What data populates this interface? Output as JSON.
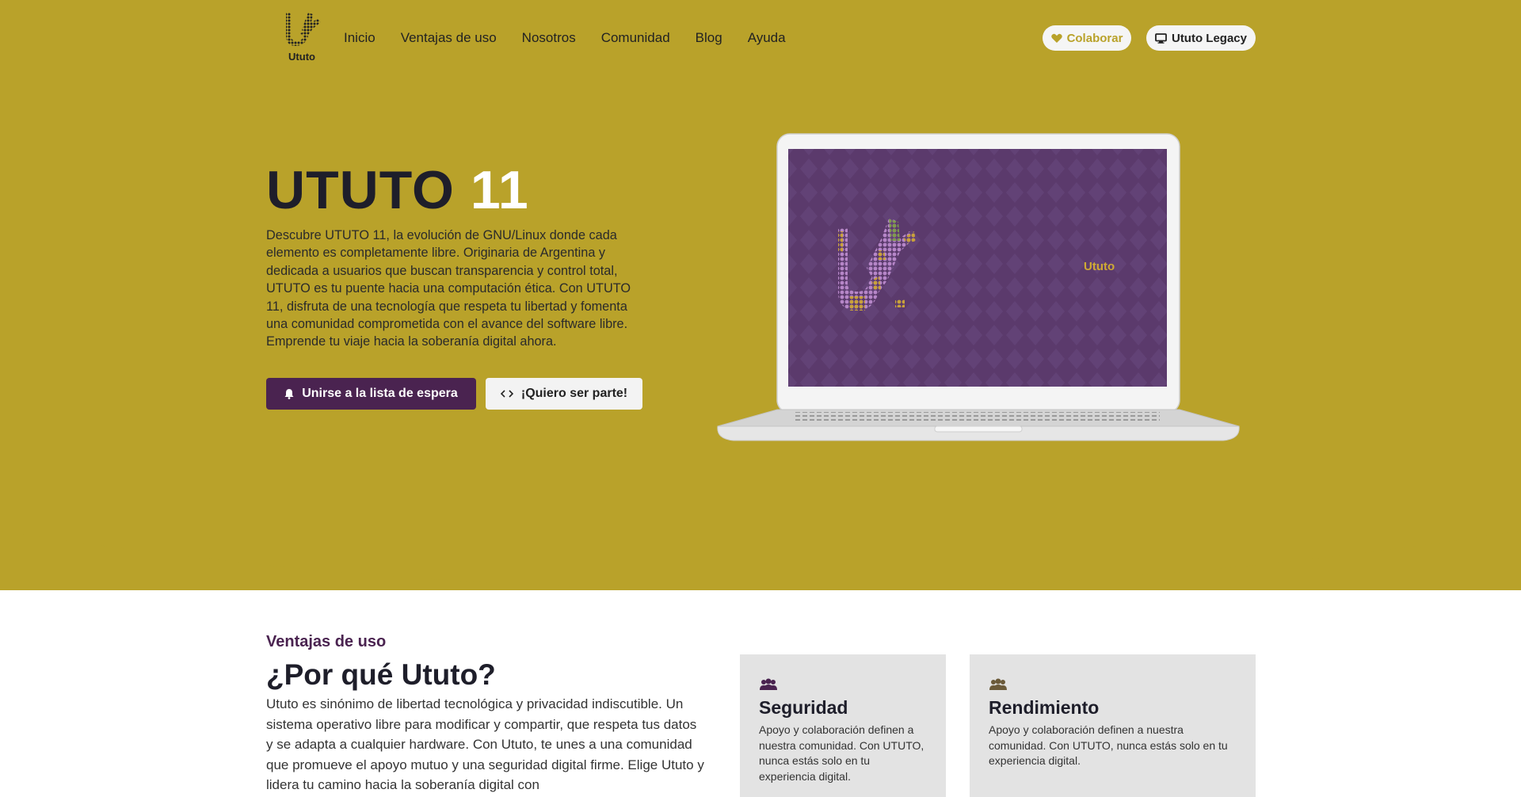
{
  "nav": {
    "logo_text": "Ututo",
    "menu": [
      "Inicio",
      "Ventajas de uso",
      "Nosotros",
      "Comunidad",
      "Blog",
      "Ayuda"
    ],
    "colaborar": "Colaborar",
    "legacy": "Ututo Legacy"
  },
  "hero": {
    "title_dark": "UTUTO",
    "title_light": "11",
    "description": "Descubre UTUTO 11, la evolución de GNU/Linux donde cada elemento es completamente libre. Originaria de Argentina y dedicada a usuarios que buscan transparencia y control total, UTUTO es tu puente hacia una computación ética. Con UTUTO 11, disfruta de una tecnología que respeta tu libertad y fomenta una comunidad comprometida con el avance del software libre. Emprende tu viaje hacia la soberanía digital ahora.",
    "btn_waitlist": "Unirse a la lista de espera",
    "btn_participate": "¡Quiero ser parte!",
    "screen_brand": "Ututo"
  },
  "advantages": {
    "kicker": "Ventajas de uso",
    "title": "¿Por qué Ututo?",
    "description": "Ututo es sinónimo de libertad tecnológica y privacidad indiscutible. Un sistema operativo libre para modificar y compartir, que respeta tus datos y se adapta a cualquier hardware. Con Ututo, te unes a una comunidad que promueve el apoyo mutuo y una seguridad digital firme. Elige Ututo y lidera tu camino hacia la soberanía digital con",
    "cards": [
      {
        "title": "Seguridad",
        "text": "Apoyo y colaboración definen a nuestra comunidad. Con UTUTO, nunca estás solo en tu experiencia digital.",
        "icon": "users-icon"
      },
      {
        "title": "Rendimiento",
        "text": "Apoyo y colaboración definen a nuestra comunidad. Con UTUTO, nunca estás solo en tu experiencia digital.",
        "icon": "users-icon"
      }
    ]
  },
  "colors": {
    "brand_gold": "#b9a22a",
    "brand_purple": "#4a2350",
    "dark": "#1e1e2a"
  }
}
